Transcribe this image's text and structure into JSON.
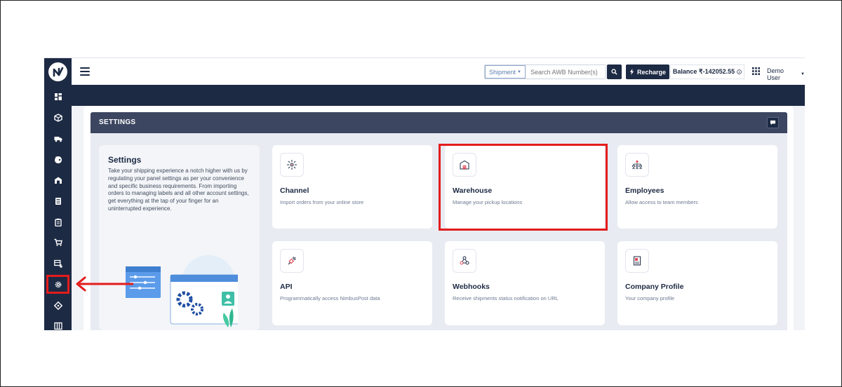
{
  "header": {
    "shipment_select": "Shipment",
    "search_placeholder": "Search AWB Number(s)",
    "recharge_label": "Recharge",
    "balance_label": "Balance ₹-142052.55",
    "user_name": "Demo User"
  },
  "sidebar": {
    "items": [
      {
        "icon": "dashboard-icon"
      },
      {
        "icon": "package-icon"
      },
      {
        "icon": "truck-icon"
      },
      {
        "icon": "wallet-icon"
      },
      {
        "icon": "warehouse-icon"
      },
      {
        "icon": "document-icon"
      },
      {
        "icon": "clipboard-icon"
      },
      {
        "icon": "cart-icon"
      },
      {
        "icon": "bulk-upload-icon"
      },
      {
        "icon": "settings-gear-icon",
        "active": true
      },
      {
        "icon": "tag-icon"
      },
      {
        "icon": "map-icon"
      }
    ]
  },
  "page": {
    "section_title": "SETTINGS"
  },
  "intro": {
    "title": "Settings",
    "text": "Take your shipping experience a notch higher with us by regulating your panel settings as per your convenience and specific business requirements. From importing orders to managing labels and all other account settings, get everything at the tap of your finger for an uninterrupted experience."
  },
  "tiles": [
    {
      "title": "Channel",
      "desc": "Import orders from your online store",
      "icon": "channel-icon"
    },
    {
      "title": "Warehouse",
      "desc": "Manage your pickup locations",
      "icon": "warehouse-icon"
    },
    {
      "title": "Employees",
      "desc": "Allow access to team members",
      "icon": "employees-icon"
    },
    {
      "title": "API",
      "desc": "Programmatically access NimbusPost data",
      "icon": "api-plug-icon"
    },
    {
      "title": "Webhooks",
      "desc": "Receive shipments status notification on URL",
      "icon": "webhook-icon"
    },
    {
      "title": "Company Profile",
      "desc": "Your company profile",
      "icon": "company-profile-icon"
    }
  ],
  "colors": {
    "brand_navy": "#1d2a44",
    "settings_bar": "#3c4660",
    "annotation_red": "#e41c1c"
  }
}
